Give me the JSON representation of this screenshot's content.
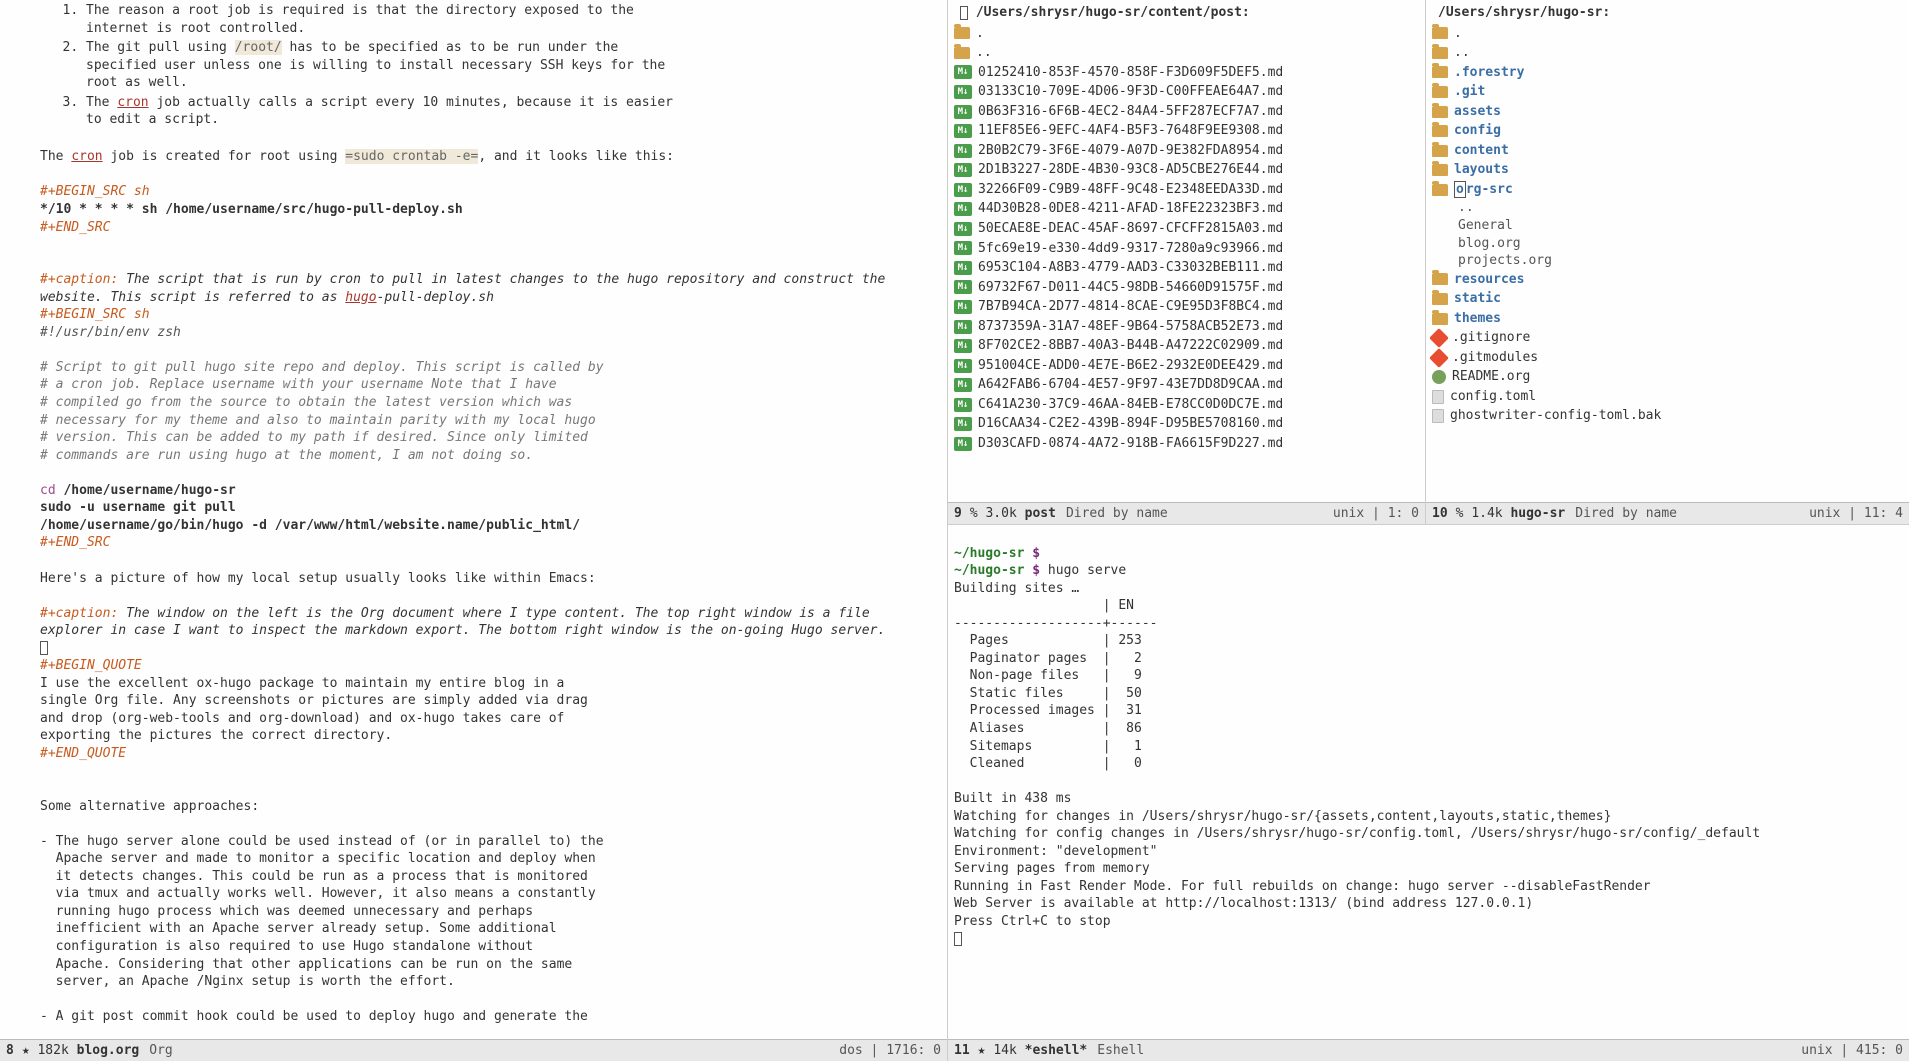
{
  "left": {
    "list_items": [
      "The reason a root job is required is that the directory exposed to the internet is root controlled.",
      "The git pull using /root/ has to be specified as to be run under the specified user unless one is willing to install necessary SSH keys for the root as well.",
      "The cron job actually calls a script every 10 minutes, because it is easier to edit a script."
    ],
    "cron_sentence_pre": "The ",
    "cron_link": "cron",
    "cron_sentence_mid": " job is created for root using ",
    "cron_cmd": "=sudo crontab -e=",
    "cron_sentence_post": ", and it looks like this:",
    "src1_begin": "#+BEGIN_SRC sh",
    "src1_line": "*/10 * * * * sh /home/username/src/hugo-pull-deploy.sh",
    "src1_end": "#+END_SRC",
    "caption1_label": "#+caption:",
    "caption1_text": " The script that is run by cron to pull in latest changes to the hugo repository and construct the website. This script is referred to as ",
    "caption1_link": "hugo",
    "caption1_tail": "-pull-deploy.sh",
    "src2_begin": "#+BEGIN_SRC sh",
    "src2_shebang": "#!/usr/bin/env zsh",
    "src2_c1": "# Script to git pull hugo site repo and deploy. This script is called by",
    "src2_c2": "# a cron job. Replace username with your username Note that I have",
    "src2_c3": "# compiled go from the source to obtain the latest version which was",
    "src2_c4": "# necessary for my theme and also to maintain parity with my local hugo",
    "src2_c5": "# version. This can be added to my path if desired. Since only limited",
    "src2_c6": "# commands are run using hugo at the moment, I am not doing so.",
    "src2_cd_kw": "cd",
    "src2_cd_path": " /home/username/hugo-sr",
    "src2_l2": "sudo -u username git pull",
    "src2_l3": "/home/username/go/bin/hugo -d /var/www/html/website.name/public_html/",
    "src2_end": "#+END_SRC",
    "pic_line": "Here's a picture of how my local setup usually looks like within Emacs:",
    "caption2_label": "#+caption:",
    "caption2_text": " The window on the left is the Org document where I type content. The top right window is a file explorer in case I want to inspect the markdown export. The bottom right window is the on-going Hugo server.",
    "quote_begin": "#+BEGIN_QUOTE",
    "quote_l1": "I use the excellent ox-hugo package to maintain my entire blog in a",
    "quote_l2": "single Org file. Any screenshots or pictures are simply added via drag",
    "quote_l3": "and drop (org-web-tools and org-download) and ox-hugo takes care of",
    "quote_l4": "exporting the pictures the correct directory.",
    "quote_end": "#+END_QUOTE",
    "alt_heading": "Some alternative approaches:",
    "alt1": "- The hugo server alone could be used instead of (or in parallel to) the\n  Apache server and made to monitor a specific location and deploy when\n  it detects changes. This could be run as a process that is monitored\n  via tmux and actually works well. However, it also means a constantly\n  running hugo process which was deemed unnecessary and perhaps\n  inefficient with an Apache server already setup. Some additional\n  configuration is also required to use Hugo standalone without\n  Apache. Considering that other applications can be run on the same\n  server, an Apache /Nginx setup is worth the effort.",
    "alt2": "- A git post commit hook could be used to deploy hugo and generate the",
    "modeline": {
      "num": "8",
      "size": "182k",
      "buf": "blog.org",
      "mode": "Org",
      "right": "dos | 1716: 0"
    }
  },
  "dired_post": {
    "path": "/Users/shrysr/hugo-sr/content/post:",
    "dot": ".",
    "dotdot": "..",
    "files": [
      "01252410-853F-4570-858F-F3D609F5DEF5.md",
      "03133C10-709E-4D06-9F3D-C00FFEAE64A7.md",
      "0B63F316-6F6B-4EC2-84A4-5FF287ECF7A7.md",
      "11EF85E6-9EFC-4AF4-B5F3-7648F9EE9308.md",
      "2B0B2C79-3F6E-4079-A07D-9E382FDA8954.md",
      "2D1B3227-28DE-4B30-93C8-AD5CBE276E44.md",
      "32266F09-C9B9-48FF-9C48-E2348EEDA33D.md",
      "44D30B28-0DE8-4211-AFAD-18FE22323BF3.md",
      "50ECAE8E-DEAC-45AF-8697-CFCFF2815A03.md",
      "5fc69e19-e330-4dd9-9317-7280a9c93966.md",
      "6953C104-A8B3-4779-AAD3-C33032BEB111.md",
      "69732F67-D011-44C5-98DB-54660D91575F.md",
      "7B7B94CA-2D77-4814-8CAE-C9E95D3F8BC4.md",
      "8737359A-31A7-48EF-9B64-5758ACB52E73.md",
      "8F702CE2-8BB7-40A3-B44B-A47222C02909.md",
      "951004CE-ADD0-4E7E-B6E2-2932E0DEE429.md",
      "A642FAB6-6704-4E57-9F97-43E7DD8D9CAA.md",
      "C641A230-37C9-46AA-84EB-E78CC0D0DC7E.md",
      "D16CAA34-C2E2-439B-894F-D95BE5708160.md",
      "D303CAFD-0874-4A72-918B-FA6615F9D227.md"
    ],
    "modeline": {
      "num": "9",
      "pct": "%",
      "size": "3.0k",
      "buf": "post",
      "mode": "Dired by name",
      "right": "unix | 1: 0"
    }
  },
  "dired_root": {
    "path": "/Users/shrysr/hugo-sr:",
    "entries": [
      {
        "type": "folder",
        "name": "."
      },
      {
        "type": "folder",
        "name": ".."
      },
      {
        "type": "folder",
        "name": ".forestry",
        "dir": true
      },
      {
        "type": "folder",
        "name": ".git",
        "dir": true
      },
      {
        "type": "folder",
        "name": "assets",
        "dir": true
      },
      {
        "type": "folder",
        "name": "config",
        "dir": true
      },
      {
        "type": "folder",
        "name": "content",
        "dir": true
      },
      {
        "type": "folder",
        "name": "layouts",
        "dir": true
      },
      {
        "type": "folder",
        "name": "org-src",
        "dir": true,
        "cursor": true
      },
      {
        "type": "sub",
        "name": ".."
      },
      {
        "type": "sub",
        "name": "General"
      },
      {
        "type": "sub",
        "name": "blog.org"
      },
      {
        "type": "sub",
        "name": "projects.org"
      },
      {
        "type": "folder",
        "name": "resources",
        "dir": true
      },
      {
        "type": "folder",
        "name": "static",
        "dir": true
      },
      {
        "type": "folder",
        "name": "themes",
        "dir": true
      },
      {
        "type": "git",
        "name": ".gitignore"
      },
      {
        "type": "git",
        "name": ".gitmodules"
      },
      {
        "type": "org",
        "name": "README.org"
      },
      {
        "type": "file",
        "name": "config.toml"
      },
      {
        "type": "file",
        "name": "ghostwriter-config-toml.bak"
      }
    ],
    "modeline": {
      "num": "10",
      "pct": "%",
      "size": "1.4k",
      "buf": "hugo-sr",
      "mode": "Dired by name",
      "right": "unix | 11: 4"
    }
  },
  "eshell": {
    "prompt1_path": "~/hugo-sr",
    "prompt1_dollar": " $",
    "prompt2_path": "~/hugo-sr",
    "prompt2_dollar": " $",
    "cmd": " hugo serve",
    "building": "Building sites …",
    "header": "                   | EN",
    "divider": "-------------------+------",
    "row_pages": "  Pages            | 253",
    "row_paginator": "  Paginator pages  |   2",
    "row_nonpage": "  Non-page files   |   9",
    "row_static": "  Static files     |  50",
    "row_processed": "  Processed images |  31",
    "row_aliases": "  Aliases          |  86",
    "row_sitemaps": "  Sitemaps         |   1",
    "row_cleaned": "  Cleaned          |   0",
    "built": "Built in 438 ms",
    "watch1": "Watching for changes in /Users/shrysr/hugo-sr/{assets,content,layouts,static,themes}",
    "watch2": "Watching for config changes in /Users/shrysr/hugo-sr/config.toml, /Users/shrysr/hugo-sr/config/_default",
    "env": "Environment: \"development\"",
    "serving": "Serving pages from memory",
    "fast": "Running in Fast Render Mode. For full rebuilds on change: hugo server --disableFastRender",
    "webserver": "Web Server is available at http://localhost:1313/ (bind address 127.0.0.1)",
    "ctrlc": "Press Ctrl+C to stop",
    "modeline": {
      "num": "11",
      "size": "14k",
      "buf": "*eshell*",
      "mode": "Eshell",
      "right": "unix | 415: 0"
    }
  }
}
